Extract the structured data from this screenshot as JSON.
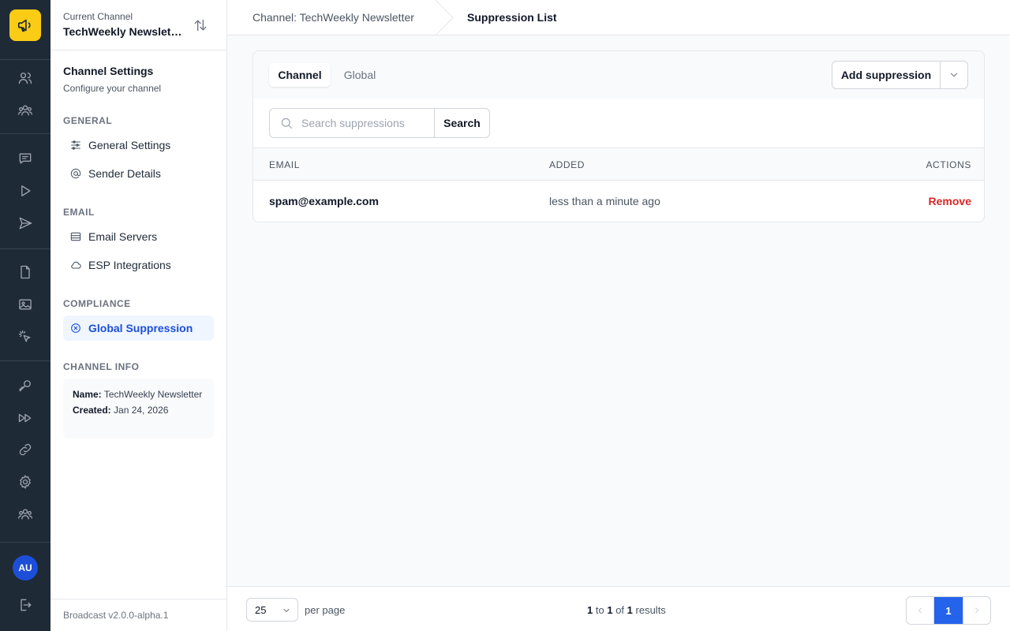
{
  "rail": {
    "avatar_initials": "AU",
    "icons": [
      "users-icon",
      "team-icon",
      "message-icon",
      "play-icon",
      "send-icon",
      "document-icon",
      "image-icon",
      "click-icon",
      "key-icon",
      "fast-forward-icon",
      "link-icon",
      "gear-icon",
      "people-icon",
      "logout-icon"
    ]
  },
  "sidebar": {
    "current_channel_label": "Current Channel",
    "current_channel_name": "TechWeekly Newsletter",
    "title": "Channel Settings",
    "subtitle": "Configure your channel",
    "sections": {
      "general": "GENERAL",
      "email": "EMAIL",
      "compliance": "COMPLIANCE",
      "channel_info": "CHANNEL INFO"
    },
    "items": {
      "general_settings": "General Settings",
      "sender_details": "Sender Details",
      "email_servers": "Email Servers",
      "esp_integrations": "ESP Integrations",
      "global_suppression": "Global Suppression"
    },
    "info": {
      "name_label": "Name:",
      "name_value": "TechWeekly Newsletter",
      "created_label": "Created:",
      "created_value": "Jan 24, 2026"
    },
    "version": "Broadcast v2.0.0-alpha.1"
  },
  "header": {
    "breadcrumb_parent": "Channel: TechWeekly Newsletter",
    "breadcrumb_current": "Suppression List"
  },
  "main": {
    "tabs": [
      {
        "label": "Channel",
        "active": true
      },
      {
        "label": "Global",
        "active": false
      }
    ],
    "add_button": "Add suppression",
    "search": {
      "placeholder": "Search suppressions",
      "value": "",
      "button": "Search"
    },
    "table": {
      "columns": [
        "EMAIL",
        "ADDED",
        "ACTIONS"
      ],
      "rows": [
        {
          "email": "spam@example.com",
          "added": "less than a minute ago",
          "action": "Remove"
        }
      ]
    }
  },
  "footer": {
    "per_page_value": "25",
    "per_page_label": "per page",
    "results": {
      "from": "1",
      "to_word": "to",
      "to": "1",
      "of_word": "of",
      "total": "1",
      "suffix": "results"
    },
    "current_page": "1"
  },
  "colors": {
    "brand": "#facc15",
    "rail_bg": "#1f2a37",
    "accent": "#2563eb",
    "danger": "#dc2626"
  }
}
